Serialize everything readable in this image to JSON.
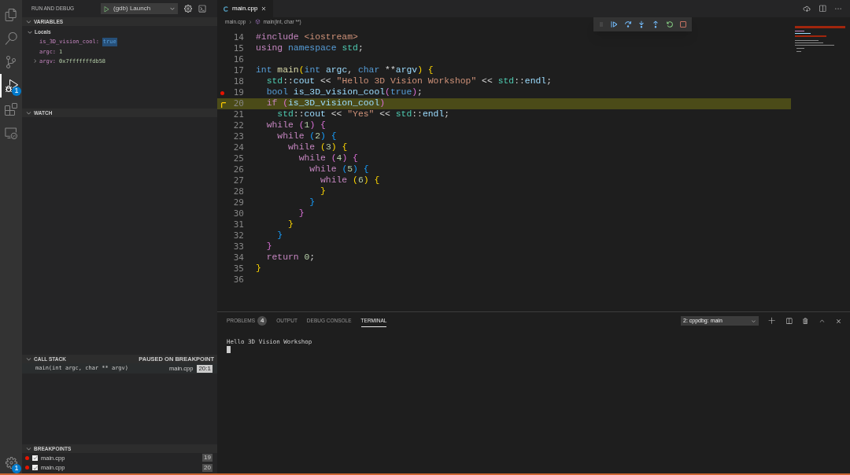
{
  "activity_bar": {
    "items": [
      {
        "kind": "explorer",
        "selected": false
      },
      {
        "kind": "search",
        "selected": false
      },
      {
        "kind": "source_control",
        "selected": false
      },
      {
        "kind": "debug",
        "selected": true,
        "badge": "1"
      },
      {
        "kind": "extensions",
        "selected": false
      },
      {
        "kind": "remote",
        "selected": false
      }
    ],
    "settings_badge": "1"
  },
  "sidebar": {
    "title": "RUN AND DEBUG",
    "launch_config": "(gdb) Launch",
    "variables": {
      "title": "VARIABLES",
      "expanded": true,
      "scope": {
        "label": "Locals",
        "expanded": true,
        "items": [
          {
            "name": "is_3D_vision_cool:",
            "value": "true",
            "selected": true,
            "expandable": false
          },
          {
            "name": "argc:",
            "value": "1",
            "selected": false,
            "expandable": false
          },
          {
            "name": "argv:",
            "value": "0x7fffffffdb58",
            "selected": false,
            "expandable": true
          }
        ]
      }
    },
    "watch": {
      "title": "WATCH",
      "expanded": true
    },
    "call_stack": {
      "title": "CALL STACK",
      "expanded": true,
      "status": "PAUSED ON BREAKPOINT",
      "frames": [
        {
          "function": "main(int argc, char ** argv)",
          "file": "main.cpp",
          "position": "20:1"
        }
      ]
    },
    "breakpoints": {
      "title": "BREAKPOINTS",
      "expanded": true,
      "items": [
        {
          "file": "main.cpp",
          "line": "19",
          "checked": true
        },
        {
          "file": "main.cpp",
          "line": "20",
          "checked": true
        }
      ]
    }
  },
  "editor": {
    "tabs": [
      {
        "label": "main.cpp",
        "selected": true
      }
    ],
    "breadcrumb": [
      "main.cpp",
      "main(int, char **)"
    ],
    "lines": [
      {
        "number": "14",
        "breakpoint": false,
        "current": false,
        "tokens": [
          {
            "kind": "k",
            "text": "#include"
          },
          {
            "kind": "s",
            "text": " <iostream>"
          }
        ]
      },
      {
        "number": "15",
        "breakpoint": false,
        "current": false,
        "tokens": [
          {
            "kind": "k",
            "text": "using"
          },
          {
            "kind": "t",
            "text": " namespace"
          },
          {
            "kind": "n",
            "text": " std"
          },
          {
            "kind": "p",
            "text": ";"
          }
        ]
      },
      {
        "number": "16",
        "breakpoint": false,
        "current": false
      },
      {
        "number": "17",
        "breakpoint": false,
        "current": false,
        "tokens": [
          {
            "kind": "t",
            "text": "int"
          },
          {
            "kind": "f",
            "text": " main"
          },
          {
            "kind": "b1",
            "text": "("
          },
          {
            "kind": "t",
            "text": "int"
          },
          {
            "kind": "v",
            "text": " argc"
          },
          {
            "kind": "p",
            "text": ","
          },
          {
            "kind": "t",
            "text": " char"
          },
          {
            "kind": "p",
            "text": " **"
          },
          {
            "kind": "v",
            "text": "argv"
          },
          {
            "kind": "b1",
            "text": ")"
          },
          {
            "kind": "b1",
            "text": " {"
          }
        ]
      },
      {
        "number": "18",
        "breakpoint": false,
        "current": false,
        "tokens": [
          {
            "kind": "n",
            "text": "  std"
          },
          {
            "kind": "p",
            "text": "::"
          },
          {
            "kind": "v",
            "text": "cout"
          },
          {
            "kind": "p",
            "text": " <<"
          },
          {
            "kind": "s",
            "text": " \"Hello 3D Vision Workshop\""
          },
          {
            "kind": "p",
            "text": " <<"
          },
          {
            "kind": "n",
            "text": " std"
          },
          {
            "kind": "p",
            "text": "::"
          },
          {
            "kind": "v",
            "text": "endl"
          },
          {
            "kind": "p",
            "text": ";"
          }
        ]
      },
      {
        "number": "19",
        "breakpoint": true,
        "current": false,
        "tokens": [
          {
            "kind": "t",
            "text": "  bool"
          },
          {
            "kind": "v",
            "text": " is_3D_vision_cool"
          },
          {
            "kind": "b2",
            "text": "("
          },
          {
            "kind": "t",
            "text": "true"
          },
          {
            "kind": "b2",
            "text": ")"
          },
          {
            "kind": "p",
            "text": ";"
          }
        ]
      },
      {
        "number": "20",
        "breakpoint": false,
        "current": true,
        "tokens": [
          {
            "kind": "k",
            "text": "  if"
          },
          {
            "kind": "b2",
            "text": " ("
          },
          {
            "kind": "v",
            "text": "is_3D_vision_cool"
          },
          {
            "kind": "b2",
            "text": ")"
          }
        ]
      },
      {
        "number": "21",
        "breakpoint": false,
        "current": false,
        "tokens": [
          {
            "kind": "n",
            "text": "    std"
          },
          {
            "kind": "p",
            "text": "::"
          },
          {
            "kind": "v",
            "text": "cout"
          },
          {
            "kind": "p",
            "text": " <<"
          },
          {
            "kind": "s",
            "text": " \"Yes\""
          },
          {
            "kind": "p",
            "text": " <<"
          },
          {
            "kind": "n",
            "text": " std"
          },
          {
            "kind": "p",
            "text": "::"
          },
          {
            "kind": "v",
            "text": "endl"
          },
          {
            "kind": "p",
            "text": ";"
          }
        ]
      },
      {
        "number": "22",
        "breakpoint": false,
        "current": false,
        "tokens": [
          {
            "kind": "k",
            "text": "  while"
          },
          {
            "kind": "b2",
            "text": " ("
          },
          {
            "kind": "num",
            "text": "1"
          },
          {
            "kind": "b2",
            "text": ")"
          },
          {
            "kind": "b2",
            "text": " {"
          }
        ]
      },
      {
        "number": "23",
        "breakpoint": false,
        "current": false,
        "tokens": [
          {
            "kind": "k",
            "text": "    while"
          },
          {
            "kind": "b3",
            "text": " ("
          },
          {
            "kind": "num",
            "text": "2"
          },
          {
            "kind": "b3",
            "text": ")"
          },
          {
            "kind": "b3",
            "text": " {"
          }
        ]
      },
      {
        "number": "24",
        "breakpoint": false,
        "current": false,
        "tokens": [
          {
            "kind": "k",
            "text": "      while"
          },
          {
            "kind": "b1",
            "text": " ("
          },
          {
            "kind": "num",
            "text": "3"
          },
          {
            "kind": "b1",
            "text": ")"
          },
          {
            "kind": "b1",
            "text": " {"
          }
        ]
      },
      {
        "number": "25",
        "breakpoint": false,
        "current": false,
        "tokens": [
          {
            "kind": "k",
            "text": "        while"
          },
          {
            "kind": "b2",
            "text": " ("
          },
          {
            "kind": "num",
            "text": "4"
          },
          {
            "kind": "b2",
            "text": ")"
          },
          {
            "kind": "b2",
            "text": " {"
          }
        ]
      },
      {
        "number": "26",
        "breakpoint": false,
        "current": false,
        "tokens": [
          {
            "kind": "k",
            "text": "          while"
          },
          {
            "kind": "b3",
            "text": " ("
          },
          {
            "kind": "num",
            "text": "5"
          },
          {
            "kind": "b3",
            "text": ")"
          },
          {
            "kind": "b3",
            "text": " {"
          }
        ]
      },
      {
        "number": "27",
        "breakpoint": false,
        "current": false,
        "tokens": [
          {
            "kind": "k",
            "text": "            while"
          },
          {
            "kind": "b1",
            "text": " ("
          },
          {
            "kind": "num",
            "text": "6"
          },
          {
            "kind": "b1",
            "text": ")"
          },
          {
            "kind": "b1",
            "text": " {"
          }
        ]
      },
      {
        "number": "28",
        "breakpoint": false,
        "current": false,
        "tokens": [
          {
            "kind": "b1",
            "text": "            }"
          }
        ]
      },
      {
        "number": "29",
        "breakpoint": false,
        "current": false,
        "tokens": [
          {
            "kind": "b3",
            "text": "          }"
          }
        ]
      },
      {
        "number": "30",
        "breakpoint": false,
        "current": false,
        "tokens": [
          {
            "kind": "b2",
            "text": "        }"
          }
        ]
      },
      {
        "number": "31",
        "breakpoint": false,
        "current": false,
        "tokens": [
          {
            "kind": "b1",
            "text": "      }"
          }
        ]
      },
      {
        "number": "32",
        "breakpoint": false,
        "current": false,
        "tokens": [
          {
            "kind": "b3",
            "text": "    }"
          }
        ]
      },
      {
        "number": "33",
        "breakpoint": false,
        "current": false,
        "tokens": [
          {
            "kind": "b2",
            "text": "  }"
          }
        ]
      },
      {
        "number": "34",
        "breakpoint": false,
        "current": false,
        "tokens": [
          {
            "kind": "k",
            "text": "  return"
          },
          {
            "kind": "num",
            "text": " 0"
          },
          {
            "kind": "p",
            "text": ";"
          }
        ]
      },
      {
        "number": "35",
        "breakpoint": false,
        "current": false,
        "tokens": [
          {
            "kind": "b1",
            "text": "}"
          }
        ]
      },
      {
        "number": "36",
        "breakpoint": false,
        "current": false
      }
    ]
  },
  "panel": {
    "tabs": [
      {
        "label": "PROBLEMS",
        "badge": "4",
        "selected": false
      },
      {
        "label": "OUTPUT",
        "selected": false
      },
      {
        "label": "DEBUG CONSOLE",
        "selected": false
      },
      {
        "label": "TERMINAL",
        "selected": true
      }
    ],
    "terminal_select": "2: cppdbg: main",
    "output": [
      "Hello 3D Vision Workshop"
    ]
  }
}
